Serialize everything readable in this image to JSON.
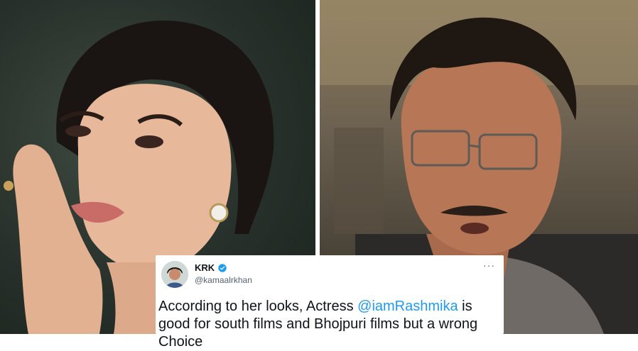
{
  "tweet": {
    "name": "KRK",
    "handle": "@kamaalrkhan",
    "more": "···",
    "text_before": "According to her looks, Actress ",
    "mention": "@iamRashmika",
    "text_after": " is good for south films and Bhojpuri films but a wrong Choice"
  },
  "colors": {
    "mention": "#1d9bf0",
    "verified": "#1d9bf0",
    "text": "#0f1419",
    "muted": "#536471"
  }
}
